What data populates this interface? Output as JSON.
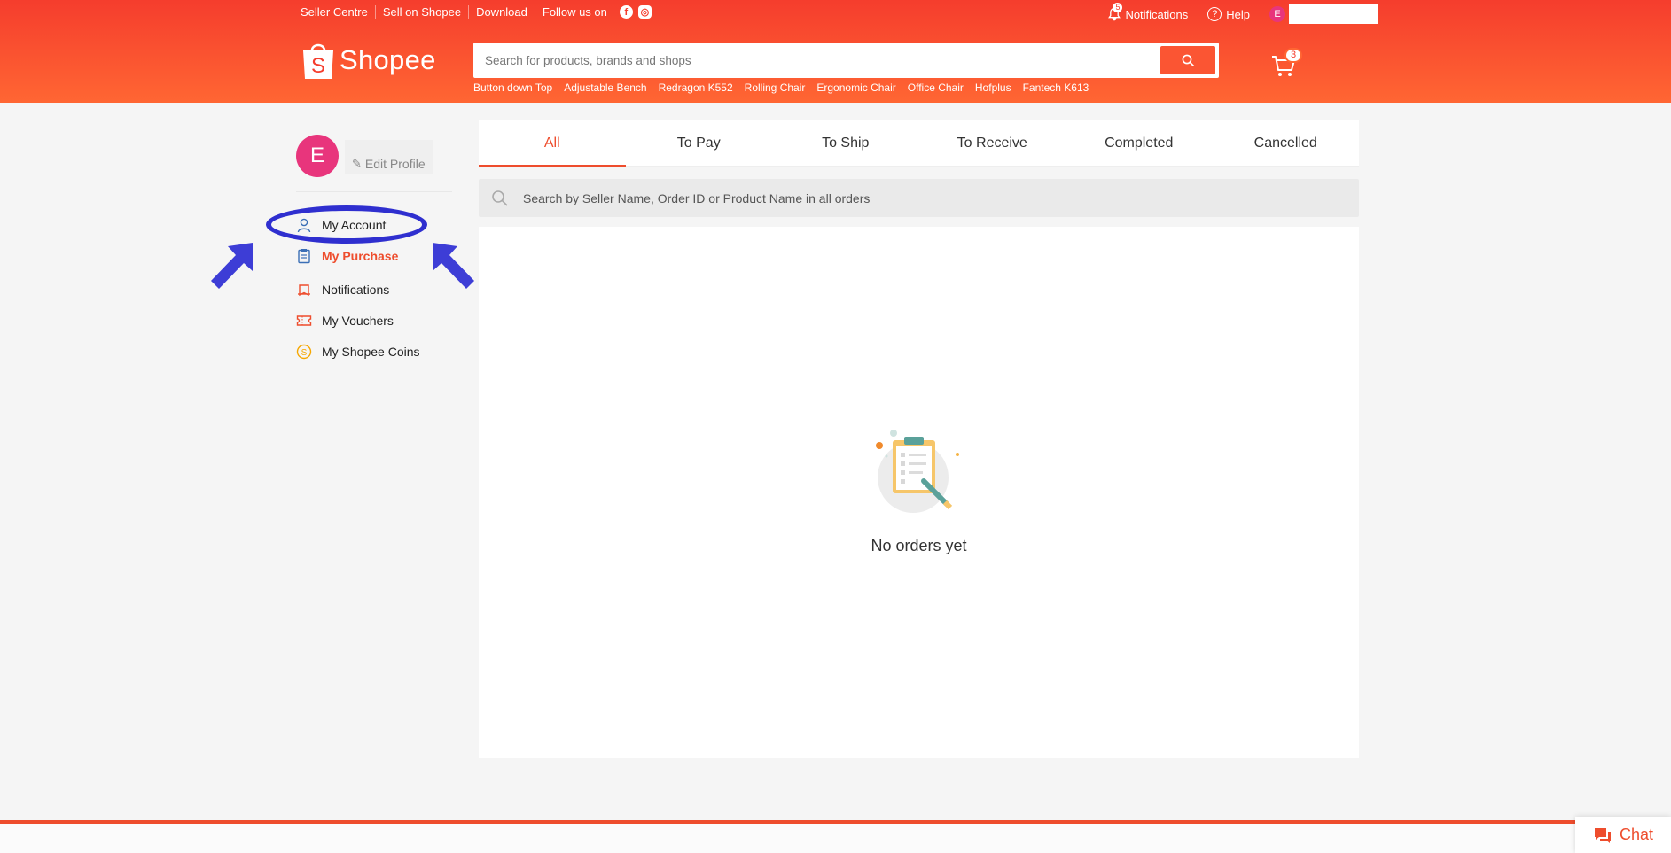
{
  "topbar": {
    "seller_centre": "Seller Centre",
    "sell_on": "Sell on Shopee",
    "download": "Download",
    "follow_us": "Follow us on",
    "notifications_label": "Notifications",
    "notifications_count": "5",
    "help_label": "Help",
    "user_initial": "E"
  },
  "header": {
    "logo_text": "Shopee",
    "search_placeholder": "Search for products, brands and shops",
    "cart_count": "3",
    "suggestions": [
      "Button down Top",
      "Adjustable Bench",
      "Redragon K552",
      "Rolling Chair",
      "Ergonomic Chair",
      "Office Chair",
      "Hofplus",
      "Fantech K613"
    ]
  },
  "sidebar": {
    "avatar_initial": "E",
    "edit_profile": "Edit Profile",
    "items": [
      {
        "label": "My Account",
        "icon": "user-icon"
      },
      {
        "label": "My Purchase",
        "icon": "clipboard-icon"
      },
      {
        "label": "Notifications",
        "icon": "bell-icon"
      },
      {
        "label": "My Vouchers",
        "icon": "voucher-icon"
      },
      {
        "label": "My Shopee Coins",
        "icon": "coin-icon"
      }
    ]
  },
  "tabs": [
    "All",
    "To Pay",
    "To Ship",
    "To Receive",
    "Completed",
    "Cancelled"
  ],
  "order_search": {
    "placeholder": "Search by Seller Name, Order ID or Product Name in all orders"
  },
  "empty_state": {
    "text": "No orders yet"
  },
  "chat": {
    "label": "Chat"
  },
  "colors": {
    "brand": "#ee4d2d",
    "annotation": "#2f2fcf",
    "avatar": "#e8357c"
  }
}
